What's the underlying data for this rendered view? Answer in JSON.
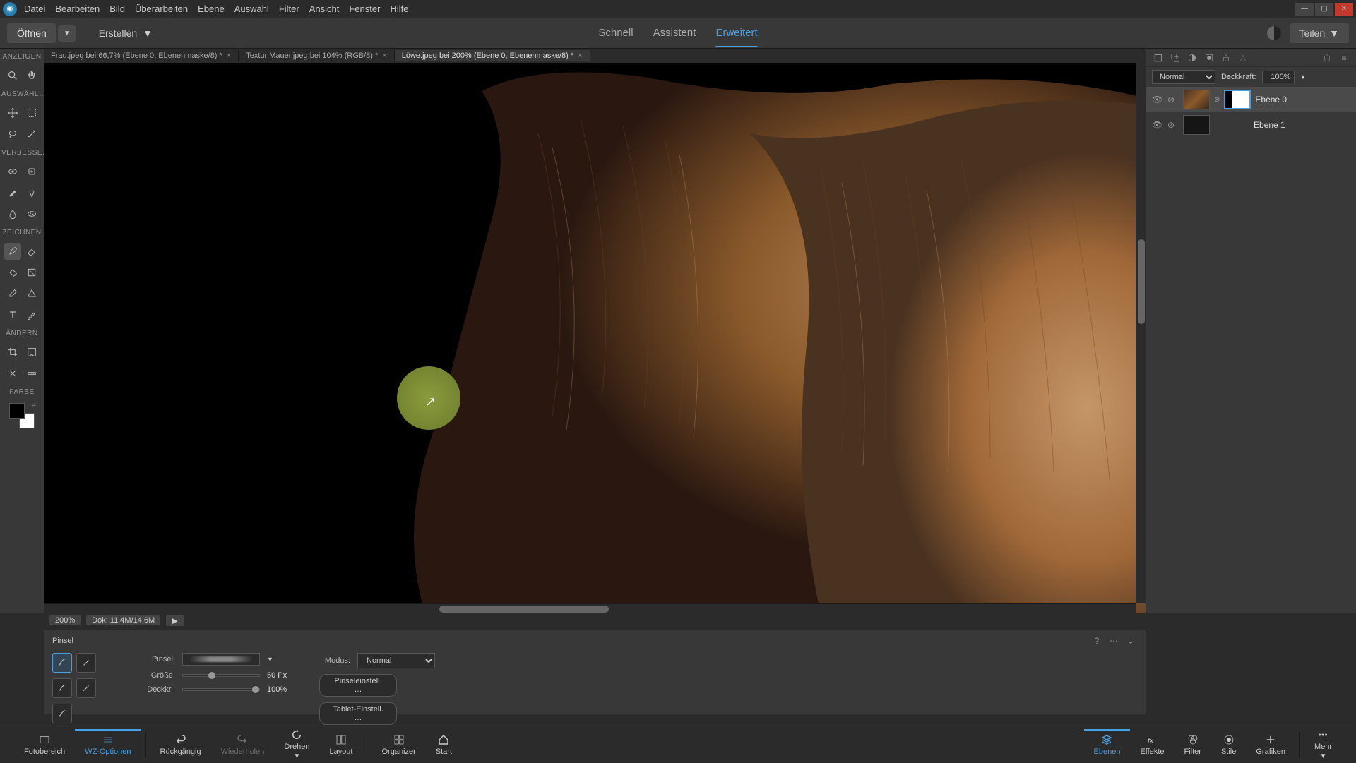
{
  "menu": {
    "items": [
      "Datei",
      "Bearbeiten",
      "Bild",
      "Überarbeiten",
      "Ebene",
      "Auswahl",
      "Filter",
      "Ansicht",
      "Fenster",
      "Hilfe"
    ]
  },
  "toolbar": {
    "open": "Öffnen",
    "create": "Erstellen",
    "share": "Teilen"
  },
  "modes": {
    "quick": "Schnell",
    "guided": "Assistent",
    "expert": "Erweitert"
  },
  "doc_tabs": [
    {
      "label": "Frau.jpeg bei 66,7% (Ebene 0, Ebenenmaske/8) *"
    },
    {
      "label": "Textur Mauer.jpeg bei 104% (RGB/8) *"
    },
    {
      "label": "Löwe.jpeg bei 200% (Ebene 0, Ebenenmaske/8) *"
    }
  ],
  "toolbox": {
    "sections": {
      "view": "ANZEIGEN",
      "select": "AUSWÄHL…",
      "enhance": "VERBESSE…",
      "draw": "ZEICHNEN",
      "modify": "ÄNDERN",
      "color": "FARBE"
    }
  },
  "status": {
    "zoom": "200%",
    "doc": "Dok: 11,4M/14,6M"
  },
  "layers_panel": {
    "blend_mode": "Normal",
    "opacity_label": "Deckkraft:",
    "opacity_value": "100%",
    "layers": [
      {
        "name": "Ebene 0"
      },
      {
        "name": "Ebene 1"
      }
    ]
  },
  "options": {
    "tool_name": "Pinsel",
    "brush_label": "Pinsel:",
    "size_label": "Größe:",
    "size_value": "50 Px",
    "opacity_label": "Deckkr.:",
    "opacity_value": "100%",
    "mode_label": "Modus:",
    "mode_value": "Normal",
    "brush_settings_btn": "Pinseleinstell. …",
    "tablet_settings_btn": "Tablet-Einstell. …"
  },
  "bottom": {
    "photo_bin": "Fotobereich",
    "tool_options": "WZ-Optionen",
    "undo": "Rückgängig",
    "redo": "Wiederholen",
    "rotate": "Drehen",
    "layout": "Layout",
    "organizer": "Organizer",
    "home": "Start",
    "layers": "Ebenen",
    "effects": "Effekte",
    "filters": "Filter",
    "styles": "Stile",
    "graphics": "Grafiken",
    "more": "Mehr"
  }
}
